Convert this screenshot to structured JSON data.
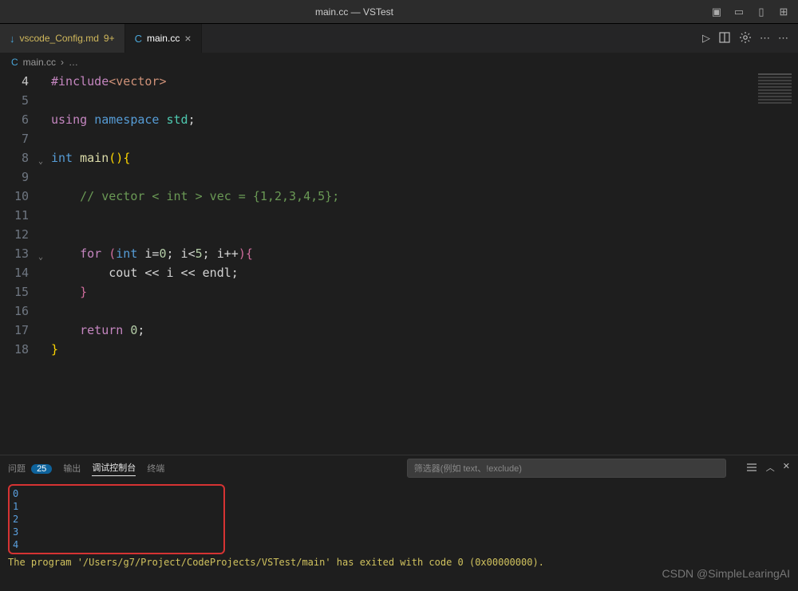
{
  "titlebar": {
    "title": "main.cc — VSTest"
  },
  "titlebar_icons": {
    "layout1": "▣",
    "layout2": "▭",
    "layout3": "▯",
    "layout4": "⊞"
  },
  "tabs": [
    {
      "icon": "↓",
      "icon_color": "#4aa6d8",
      "label": "vscode_Config.md",
      "suffix": "9+",
      "suffix_color": "#d0b85c"
    },
    {
      "icon": "C",
      "icon_color": "#4aa6d8",
      "label": "main.cc"
    }
  ],
  "tab_actions": {
    "run": "▷",
    "dots": "⋯"
  },
  "breadcrumb": {
    "icon": "C",
    "label": "main.cc",
    "sep": "›",
    "more": "…"
  },
  "code_lines": [
    {
      "n": "4",
      "html": "<span class='k-magenta'>#include</span><span class='k-orange'>&lt;vector&gt;</span>"
    },
    {
      "n": "5",
      "html": ""
    },
    {
      "n": "6",
      "html": "<span class='k-magenta'>using</span> <span class='k-blue'>namespace</span> <span class='k-type'>std</span><span class='k-white'>;</span>"
    },
    {
      "n": "7",
      "html": ""
    },
    {
      "n": "8",
      "html": "<span class='k-blue'>int</span> <span class='k-yellow'>main</span><span class='k-lyellow'>()</span><span class='k-lyellow'>{</span>"
    },
    {
      "n": "9",
      "html": ""
    },
    {
      "n": "10",
      "html": "    <span class='k-green'>// vector &lt; int &gt; vec = {1,2,3,4,5};</span>"
    },
    {
      "n": "11",
      "html": ""
    },
    {
      "n": "12",
      "html": ""
    },
    {
      "n": "13",
      "html": "    <span class='k-magenta'>for</span> <span class='k-pink'>(</span><span class='k-blue'>int</span> <span class='k-white'>i=</span><span class='k-num'>0</span><span class='k-white'>; i&lt;</span><span class='k-num'>5</span><span class='k-white'>; i++</span><span class='k-pink'>)</span><span class='k-pink'>{</span>"
    },
    {
      "n": "14",
      "html": "        <span class='k-white'>cout &lt;&lt; i &lt;&lt; endl;</span>"
    },
    {
      "n": "15",
      "html": "    <span class='k-pink'>}</span>"
    },
    {
      "n": "16",
      "html": ""
    },
    {
      "n": "17",
      "html": "    <span class='k-magenta'>return</span> <span class='k-num'>0</span><span class='k-white'>;</span>"
    },
    {
      "n": "18",
      "html": "<span class='k-lyellow'>}</span>"
    }
  ],
  "active_line_idx": 0,
  "fold_lines": [
    4,
    9
  ],
  "panel": {
    "tabs": {
      "problems": "问题",
      "problems_count": "25",
      "output": "输出",
      "debug": "调试控制台",
      "terminal": "终端"
    },
    "filter_placeholder": "筛选器(例如 text、!exclude)"
  },
  "console": {
    "output": [
      "0",
      "1",
      "2",
      "3",
      "4"
    ],
    "exit": "The program '/Users/g7/Project/CodeProjects/VSTest/main' has exited with code 0 (0x00000000)."
  },
  "watermark": "CSDN @SimpleLearingAI"
}
